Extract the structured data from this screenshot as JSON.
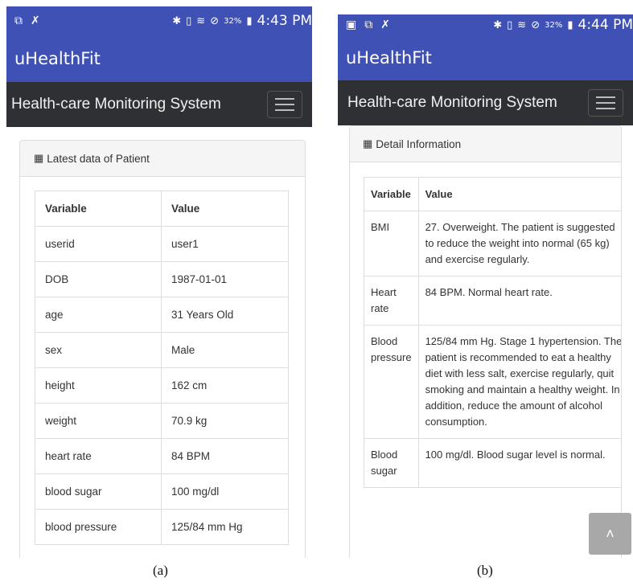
{
  "phone_a": {
    "status": {
      "time": "4:43 PM",
      "battery": "32%"
    },
    "app_title": "uHealthFit",
    "nav_title": "Health-care Monitoring System",
    "panel_title": "Latest data of Patient",
    "table": {
      "headers": [
        "Variable",
        "Value"
      ],
      "rows": [
        [
          "userid",
          "user1"
        ],
        [
          "DOB",
          "1987-01-01"
        ],
        [
          "age",
          "31 Years Old"
        ],
        [
          "sex",
          "Male"
        ],
        [
          "height",
          "162 cm"
        ],
        [
          "weight",
          "70.9 kg"
        ],
        [
          "heart rate",
          "84 BPM"
        ],
        [
          "blood sugar",
          "100 mg/dl"
        ],
        [
          "blood pressure",
          "125/84 mm Hg"
        ]
      ]
    }
  },
  "phone_b": {
    "status": {
      "time": "4:44 PM",
      "battery": "32%"
    },
    "app_title": "uHealthFit",
    "nav_title": "Health-care Monitoring System",
    "panel_title": "Detail Information",
    "table": {
      "headers": [
        "Variable",
        "Value"
      ],
      "rows": [
        [
          "BMI",
          "27. Overweight. The patient is suggested to reduce the weight into normal (65 kg) and exercise regularly."
        ],
        [
          "Heart rate",
          "84 BPM. Normal heart rate."
        ],
        [
          "Blood pressure",
          "125/84 mm Hg. Stage 1 hypertension. The patient is recommended to eat a healthy diet with less salt, exercise regularly, quit smoking and maintain a healthy weight. In addition, reduce the amount of alcohol consumption."
        ],
        [
          "Blood sugar",
          "100 mg/dl. Blood sugar level is normal."
        ]
      ]
    },
    "scroll_top_icon": "chevron-up-icon"
  },
  "captions": {
    "a": "(a)",
    "b": "(b)"
  },
  "colors": {
    "app_bar": "#3f51b5",
    "nav_bar": "#2e3033",
    "panel_heading": "#f5f5f5"
  }
}
